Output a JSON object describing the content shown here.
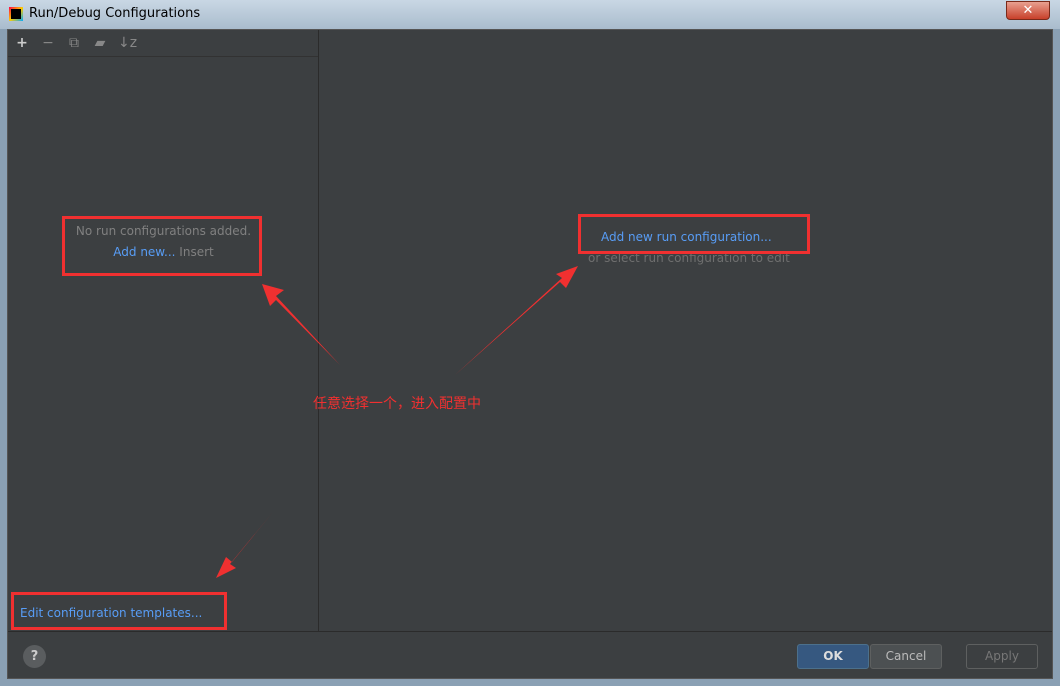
{
  "window": {
    "title": "Run/Debug Configurations",
    "close": "✕"
  },
  "toolbar": {
    "add": "+",
    "remove": "−",
    "copy": "⧉",
    "folder": "▰",
    "sort": "↓z"
  },
  "left": {
    "empty": "No run configurations added.",
    "add_new": "Add new...",
    "insert": "Insert",
    "templates": "Edit configuration templates..."
  },
  "right": {
    "add_link": "Add new run configuration...",
    "hint": "or select run configuration to edit"
  },
  "annotation": "任意选择一个，进入配置中",
  "footer": {
    "help": "?",
    "ok": "OK",
    "cancel": "Cancel",
    "apply": "Apply"
  },
  "colors": {
    "annotation": "#f03030",
    "link": "#589df6",
    "background": "#3c3f41"
  }
}
